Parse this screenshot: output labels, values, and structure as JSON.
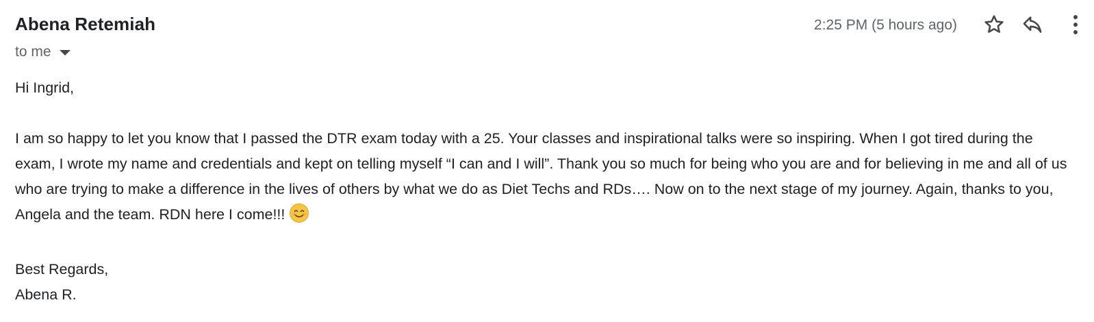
{
  "email": {
    "sender": "Abena Retemiah",
    "recipient_label": "to me",
    "timestamp": "2:25 PM (5 hours ago)",
    "greeting": "Hi Ingrid,",
    "body": "I am so happy to let you know that I passed the DTR exam today with a 25. Your classes and inspirational talks were so inspiring. When I got tired during the exam, I wrote my name and credentials and kept on telling myself “I can and I will”. Thank you so much for being who you are and for believing in me and all of us who are trying to make a difference in the lives of others by what we do as Diet Techs and RDs…. Now on to the next stage of my journey. Again, thanks to you, Angela and the team. RDN here I come!!!",
    "emoji": "smiling-face-icon",
    "signoff": "Best Regards,",
    "signature": "Abena R."
  },
  "icons": {
    "star": "star-icon",
    "reply": "reply-icon",
    "more": "more-vert-icon",
    "caret": "caret-down-icon"
  },
  "colors": {
    "text": "#202124",
    "secondary": "#5f6368",
    "icon": "#444746",
    "emoji_face": "#F6C544"
  }
}
